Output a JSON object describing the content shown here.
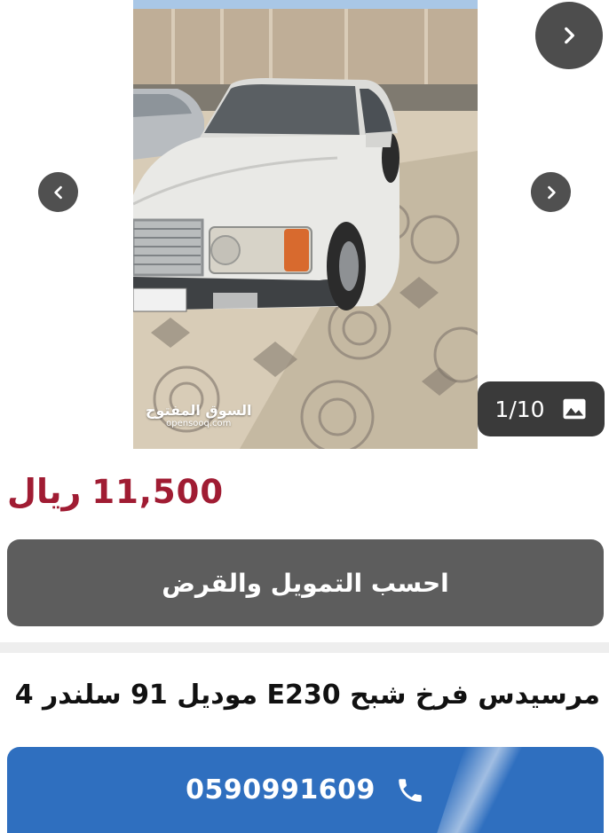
{
  "gallery": {
    "counter": "1/10",
    "watermark_ar": "السوق المفتوح",
    "watermark_en": "opensooq.com"
  },
  "price": {
    "value": "11,500",
    "currency": "ريال"
  },
  "finance_button": {
    "label": "احسب التمويل والقرض"
  },
  "ad": {
    "title": "مرسيدس فرخ شبح E230 موديل 91 سلندر 4"
  },
  "call_button": {
    "phone": "0590991609"
  },
  "colors": {
    "price": "#a01c33",
    "finance_button": "#5d5d5d",
    "call_button": "#2f6fbf"
  },
  "icons": {
    "top_next": "chevron-right-icon",
    "prev": "chevron-left-icon",
    "next": "chevron-right-icon",
    "counter": "image-icon",
    "call": "phone-icon"
  }
}
